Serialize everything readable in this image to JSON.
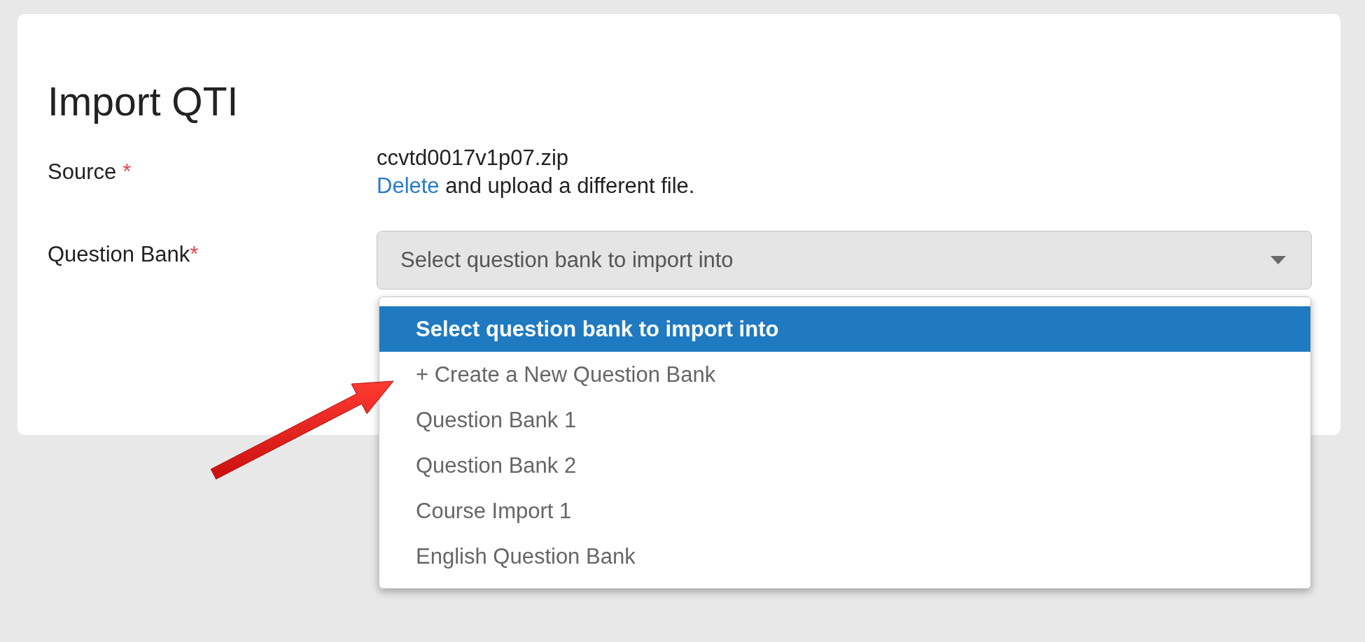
{
  "page": {
    "title": "Import QTI"
  },
  "form": {
    "source": {
      "label": "Source",
      "required_mark": "*",
      "file_name": "ccvtd0017v1p07.zip",
      "delete_link": "Delete",
      "delete_text": "and upload a different file."
    },
    "question_bank": {
      "label": "Question Bank",
      "required_mark": "*",
      "select": {
        "value": "Select question bank to import into",
        "expanded": true,
        "options": [
          {
            "label": "Select question bank to import into",
            "selected": true
          },
          {
            "label": "+ Create a New Question Bank",
            "selected": false
          },
          {
            "label": "Question Bank 1",
            "selected": false
          },
          {
            "label": "Question Bank 2",
            "selected": false
          },
          {
            "label": "Course Import 1",
            "selected": false
          },
          {
            "label": "English Question Bank",
            "selected": false
          }
        ]
      }
    }
  }
}
